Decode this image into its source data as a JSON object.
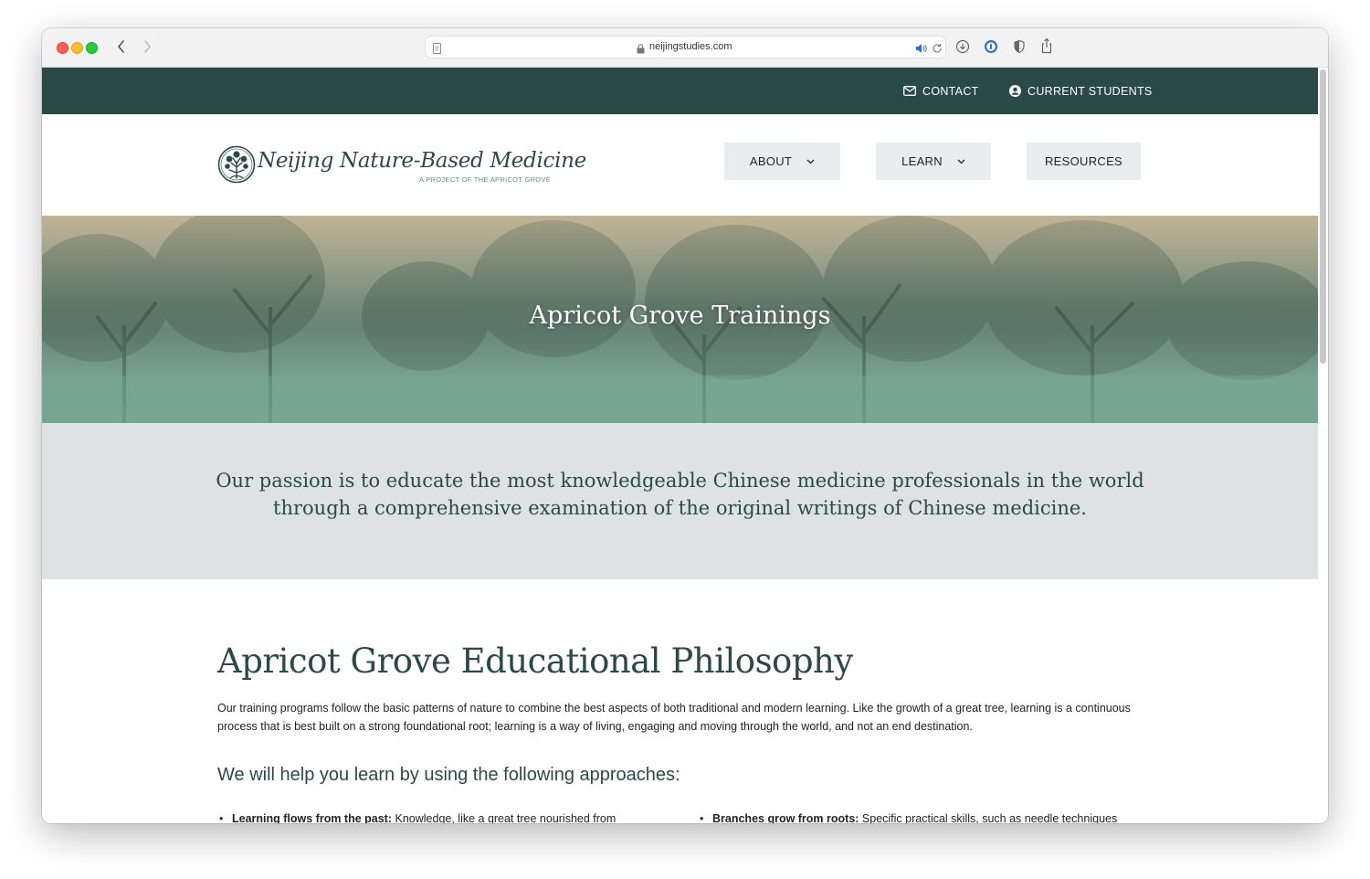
{
  "browser": {
    "url": "neijingstudies.com"
  },
  "colors": {
    "brand_dark_green": "#2b4a45",
    "nav_button_bg": "#eaeded",
    "mission_bg": "#dee2e2"
  },
  "topbar": {
    "contact_label": "CONTACT",
    "contact_icon": "envelope-icon",
    "students_label": "CURRENT STUDENTS",
    "students_icon": "user-circle-icon"
  },
  "header": {
    "logo_title": "Neijing Nature-Based Medicine",
    "logo_subtitle": "A PROJECT OF THE APRICOT GROVE",
    "nav": {
      "about": "ABOUT",
      "learn": "LEARN",
      "resources": "RESOURCES"
    }
  },
  "hero": {
    "title": "Apricot Grove Trainings"
  },
  "mission": {
    "text": "Our passion is to educate the most knowledgeable Chinese medicine professionals in the world through a comprehensive examination of the original writings of Chinese medicine."
  },
  "philosophy": {
    "title": "Apricot Grove Educational Philosophy",
    "body": "Our training programs follow the basic patterns of nature to combine the best aspects of both traditional and modern learning. Like the growth of a great tree, learning is a continuous process that is best built on a strong foundational root; learning is a way of living, engaging and moving through the world, and not an end destination.",
    "approaches_title": "We will help you learn by using the following approaches:",
    "bullets": [
      {
        "label": "Learning flows from the past:",
        "text": " Knowledge, like a great tree nourished from"
      },
      {
        "label": "Branches grow from roots:",
        "text": " Specific practical skills, such as needle techniques"
      }
    ]
  }
}
